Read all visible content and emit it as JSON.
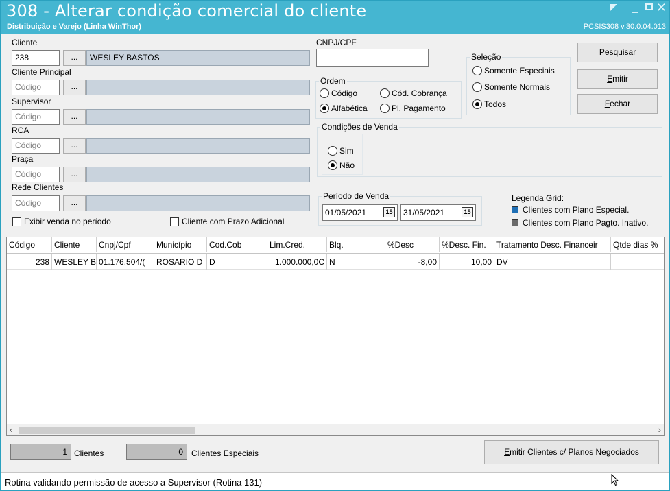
{
  "window": {
    "title": "308 - Alterar condição comercial do cliente",
    "subtitle": "Distribuição e Varejo (Linha WinThor)",
    "version": "PCSIS308  v.30.0.04.013",
    "close_glyph": "✕",
    "min_glyph": "_"
  },
  "filters": {
    "dots_label": "...",
    "cliente": {
      "label": "Cliente",
      "code": "238",
      "name": "WESLEY BASTOS"
    },
    "cliente_principal": {
      "label": "Cliente Principal",
      "placeholder": "Código",
      "name": ""
    },
    "supervisor": {
      "label": "Supervisor",
      "placeholder": "Código",
      "name": ""
    },
    "rca": {
      "label": "RCA",
      "placeholder": "Código",
      "name": ""
    },
    "praca": {
      "label": "Praça",
      "placeholder": "Código",
      "name": ""
    },
    "rede_clientes": {
      "label": "Rede Clientes",
      "placeholder": "Código",
      "name": ""
    },
    "exibir_venda": {
      "label": "Exibir venda no período",
      "checked": false
    },
    "prazo_adicional": {
      "label": "Cliente com Prazo Adicional",
      "checked": false
    }
  },
  "cnpj": {
    "label": "CNPJ/CPF",
    "value": ""
  },
  "ordem": {
    "title": "Ordem",
    "options": [
      "Código",
      "Cód. Cobrança",
      "Alfabética",
      "Pl. Pagamento"
    ],
    "selected": "Alfabética"
  },
  "selecao": {
    "title": "Seleção",
    "options": [
      "Somente Especiais",
      "Somente Normais",
      "Todos"
    ],
    "selected": "Todos"
  },
  "condicoes": {
    "title": "Condições de Venda",
    "options": [
      "Sim",
      "Não"
    ],
    "selected": "Não"
  },
  "periodo": {
    "title": "Período de Venda",
    "start": "01/05/2021",
    "end": "31/05/2021",
    "cal_icon_text": "15"
  },
  "buttons": {
    "pesquisar_pre": "",
    "pesquisar_key": "P",
    "pesquisar_post": "esquisar",
    "emitir_pre": "",
    "emitir_key": "E",
    "emitir_post": "mitir",
    "fechar_pre": "",
    "fechar_key": "F",
    "fechar_post": "echar",
    "emitir_planos_pre": "",
    "emitir_planos_key": "E",
    "emitir_planos_post": "mitir Clientes c/ Planos Negociados"
  },
  "legend": {
    "title": "Legenda Grid:",
    "items": [
      {
        "label": "Clientes com Plano Especial.",
        "color": "#1f6fb5"
      },
      {
        "label": "Clientes com Plano Pagto. Inativo.",
        "color": "#6b6b6b"
      }
    ]
  },
  "grid": {
    "columns": [
      "Código",
      "Cliente",
      "Cnpj/Cpf",
      "Município",
      "Cod.Cob",
      "Lim.Cred.",
      "Blq.",
      "%Desc",
      "%Desc. Fin.",
      "Tratamento Desc. Financeir",
      "Qtde dias %"
    ],
    "rows": [
      [
        "238",
        "WESLEY B",
        "01.176.504/(",
        "ROSARIO D",
        "D",
        "1.000.000,0C",
        "N",
        "-8,00",
        "10,00",
        "DV",
        ""
      ]
    ]
  },
  "footer": {
    "clientes_count": "1",
    "clientes_label": "Clientes",
    "especiais_count": "0",
    "especiais_label": "Clientes Especiais"
  },
  "status": "Rotina validando permissão de acesso a Supervisor (Rotina 131)"
}
